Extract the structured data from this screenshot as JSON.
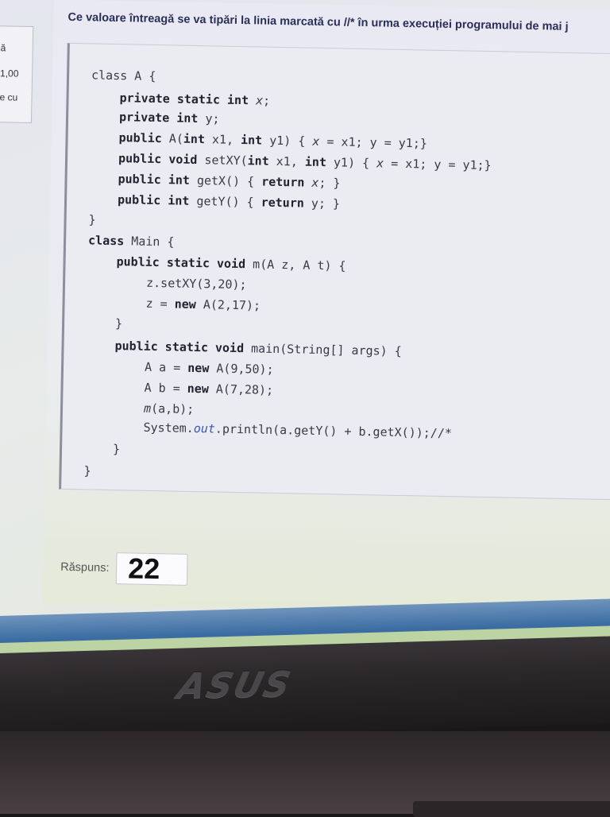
{
  "sidebar": {
    "lines": [
      "ă",
      "1,00",
      "e cu"
    ]
  },
  "question": {
    "text": "Ce valoare întreagă se va tipări la linia marcată cu //* în urma execuției programului de mai j"
  },
  "code": {
    "lines": [
      {
        "indent": 0,
        "parts": [
          [
            "",
            "class A {"
          ]
        ]
      },
      {
        "indent": 1,
        "parts": [
          [
            "kw",
            "private static int"
          ],
          [
            "it",
            " x"
          ],
          [
            "",
            ";"
          ]
        ]
      },
      {
        "indent": 1,
        "parts": [
          [
            "kw",
            "private int"
          ],
          [
            "",
            " y;"
          ]
        ]
      },
      {
        "indent": 1,
        "parts": [
          [
            "kw",
            "public"
          ],
          [
            "",
            " A("
          ],
          [
            "kw",
            "int"
          ],
          [
            "",
            " x1, "
          ],
          [
            "kw",
            "int"
          ],
          [
            "",
            " y1) { "
          ],
          [
            "it",
            "x"
          ],
          [
            "",
            " = x1; y = y1;}"
          ]
        ]
      },
      {
        "indent": 1,
        "parts": [
          [
            "kw",
            "public void"
          ],
          [
            "",
            " setXY("
          ],
          [
            "kw",
            "int"
          ],
          [
            "",
            " x1, "
          ],
          [
            "kw",
            "int"
          ],
          [
            "",
            " y1) { "
          ],
          [
            "it",
            "x"
          ],
          [
            "",
            " = x1; y = y1;}"
          ]
        ]
      },
      {
        "indent": 1,
        "parts": [
          [
            "kw",
            "public int"
          ],
          [
            "",
            " getX() { "
          ],
          [
            "kw",
            "return"
          ],
          [
            "it",
            " x"
          ],
          [
            "",
            "; }"
          ]
        ]
      },
      {
        "indent": 1,
        "parts": [
          [
            "kw",
            "public int"
          ],
          [
            "",
            " getY() { "
          ],
          [
            "kw",
            "return"
          ],
          [
            "",
            " y; }"
          ]
        ]
      },
      {
        "indent": 0,
        "parts": [
          [
            "",
            "}"
          ]
        ]
      },
      {
        "indent": 0,
        "parts": [
          [
            "kw",
            "class"
          ],
          [
            "",
            " Main {"
          ]
        ]
      },
      {
        "indent": 1,
        "parts": [
          [
            "kw",
            "public static void"
          ],
          [
            "",
            " m(A z, A t) {"
          ]
        ]
      },
      {
        "indent": 2,
        "parts": [
          [
            "",
            "z.setXY(3,20);"
          ]
        ]
      },
      {
        "indent": 2,
        "parts": [
          [
            "",
            "z = "
          ],
          [
            "kw",
            "new"
          ],
          [
            "",
            " A(2,17);"
          ]
        ]
      },
      {
        "indent": 1,
        "parts": [
          [
            "",
            "}"
          ]
        ]
      },
      {
        "indent": 1,
        "parts": [
          [
            "kw",
            "public static void"
          ],
          [
            "",
            " main(String[] args) {"
          ]
        ]
      },
      {
        "indent": 2,
        "parts": [
          [
            "",
            "A a = "
          ],
          [
            "kw",
            "new"
          ],
          [
            "",
            " A(9,50);"
          ]
        ]
      },
      {
        "indent": 2,
        "parts": [
          [
            "",
            "A b = "
          ],
          [
            "kw",
            "new"
          ],
          [
            "",
            " A(7,28);"
          ]
        ]
      },
      {
        "indent": 2,
        "parts": [
          [
            "it",
            "m"
          ],
          [
            "",
            "(a,b);"
          ]
        ]
      },
      {
        "indent": 2,
        "parts": [
          [
            "",
            "System."
          ],
          [
            "it-blue",
            "out"
          ],
          [
            "",
            ".println(a.getY() + b.getX());//*"
          ]
        ]
      },
      {
        "indent": 1,
        "parts": [
          [
            "",
            "}"
          ]
        ]
      },
      {
        "indent": 0,
        "parts": [
          [
            "",
            "}"
          ]
        ]
      }
    ]
  },
  "answer": {
    "label": "Răspuns:",
    "value": "22"
  },
  "bezel": {
    "brand": "ASUS"
  }
}
